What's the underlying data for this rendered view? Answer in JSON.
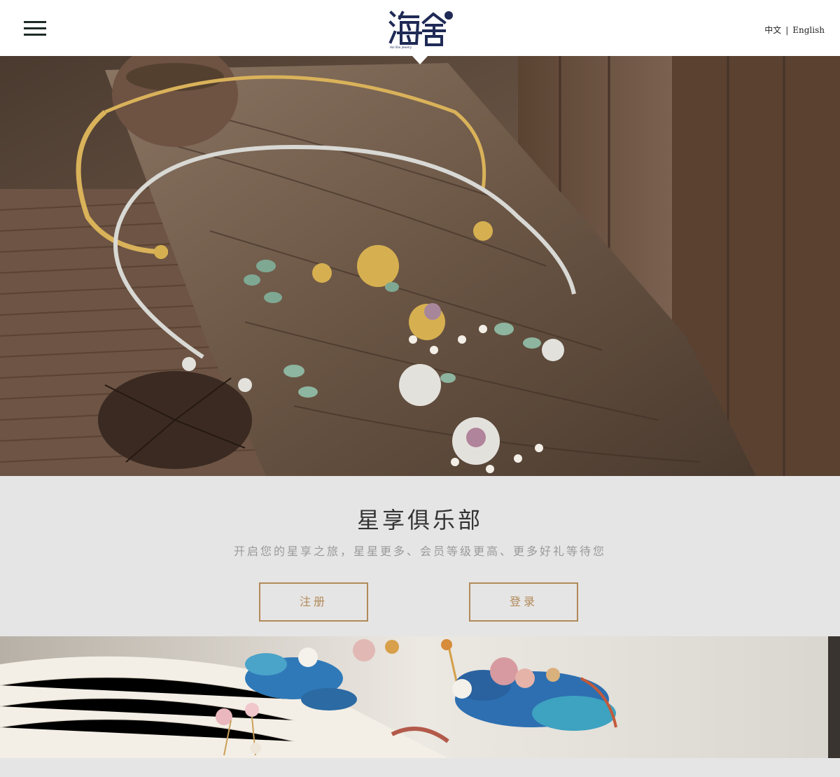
{
  "header": {
    "logo_alt": "海舍",
    "lang_zh": "中文",
    "lang_sep": "|",
    "lang_en": "English"
  },
  "club": {
    "title": "星享俱乐部",
    "subtitle": "开启您的星享之旅，星星更多、会员等级更高、更多好礼等待您",
    "register_label": "注册",
    "login_label": "登录"
  },
  "colors": {
    "accent": "#b08a5a",
    "section_bg": "#e6e5e5",
    "logo_navy": "#1f2a55"
  },
  "icons": {
    "menu": "hamburger-menu-icon"
  }
}
